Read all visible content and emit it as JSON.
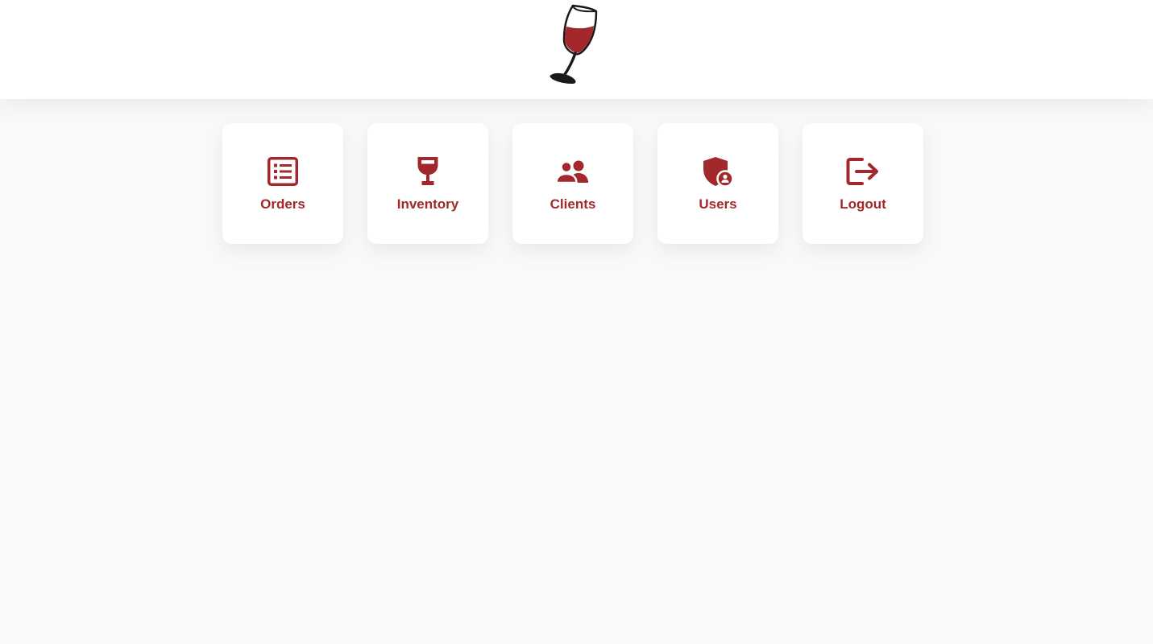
{
  "app": {
    "logo_icon": "wine-glass-logo"
  },
  "colors": {
    "accent": "#a3282c",
    "background": "#f9f9f9",
    "card": "#ffffff"
  },
  "menu": {
    "items": [
      {
        "label": "Orders",
        "icon": "list-icon"
      },
      {
        "label": "Inventory",
        "icon": "wine-glass-icon"
      },
      {
        "label": "Clients",
        "icon": "users-icon"
      },
      {
        "label": "Users",
        "icon": "user-shield-icon"
      },
      {
        "label": "Logout",
        "icon": "logout-icon"
      }
    ]
  }
}
